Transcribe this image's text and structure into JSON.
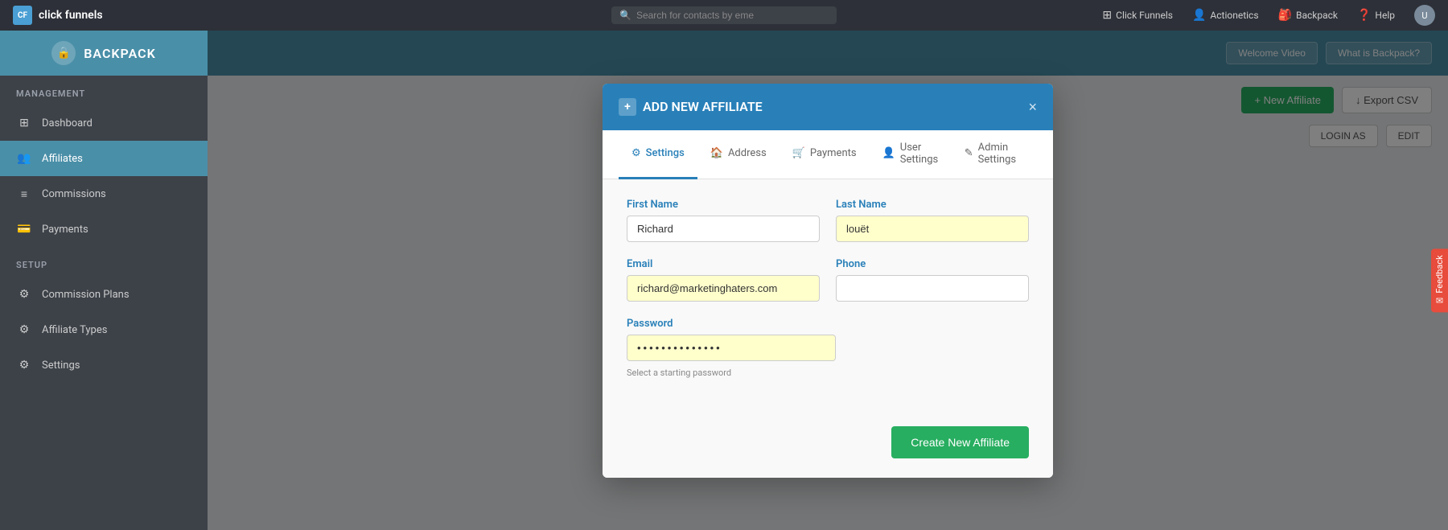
{
  "navbar": {
    "brand_icon": "CF",
    "brand_name": "click funnels",
    "search_placeholder": "Search for contacts by eme",
    "links": [
      {
        "id": "clickfunnels",
        "icon": "⊞",
        "label": "Click Funnels"
      },
      {
        "id": "actionetics",
        "icon": "👤",
        "label": "Actionetics"
      },
      {
        "id": "backpack",
        "icon": "🎒",
        "label": "Backpack"
      },
      {
        "id": "help",
        "icon": "?",
        "label": "Help"
      }
    ],
    "avatar_initials": "U"
  },
  "sidebar": {
    "title": "BACKPACK",
    "header_icon": "🔒",
    "section_management": "MANAGEMENT",
    "items_management": [
      {
        "id": "dashboard",
        "icon": "⊞",
        "label": "Dashboard",
        "active": false
      },
      {
        "id": "affiliates",
        "icon": "👤+",
        "label": "Affiliates",
        "active": true
      },
      {
        "id": "commissions",
        "icon": "≡",
        "label": "Commissions",
        "active": false
      },
      {
        "id": "payments",
        "icon": "💳",
        "label": "Payments",
        "active": false
      }
    ],
    "section_setup": "SETUP",
    "items_setup": [
      {
        "id": "commission-plans",
        "icon": "⚙",
        "label": "Commission Plans",
        "active": false
      },
      {
        "id": "affiliate-types",
        "icon": "⚙",
        "label": "Affiliate Types",
        "active": false
      },
      {
        "id": "settings",
        "icon": "⚙",
        "label": "Settings",
        "active": false
      }
    ]
  },
  "topbar": {
    "welcome_video_label": "Welcome Video",
    "what_is_backpack_label": "What is Backpack?"
  },
  "content_actions": {
    "new_affiliate_label": "+ New Affiliate",
    "export_csv_label": "↓ Export CSV",
    "login_as_label": "LOGIN AS",
    "edit_label": "EDIT"
  },
  "modal": {
    "title": "ADD NEW AFFILIATE",
    "title_icon": "+",
    "close_icon": "×",
    "tabs": [
      {
        "id": "settings",
        "icon": "⚙",
        "label": "Settings",
        "active": true
      },
      {
        "id": "address",
        "icon": "🏠",
        "label": "Address",
        "active": false
      },
      {
        "id": "payments",
        "icon": "🛒",
        "label": "Payments",
        "active": false
      },
      {
        "id": "user-settings",
        "icon": "👤",
        "label": "User Settings",
        "active": false
      },
      {
        "id": "admin-settings",
        "icon": "✎",
        "label": "Admin Settings",
        "active": false
      }
    ],
    "form": {
      "first_name_label": "First Name",
      "first_name_value": "Richard",
      "last_name_label": "Last Name",
      "last_name_value": "louët",
      "email_label": "Email",
      "email_value": "richard@marketinghaters.com",
      "phone_label": "Phone",
      "phone_value": "",
      "password_label": "Password",
      "password_value": "••••••••••••••",
      "password_hint": "Select a starting password"
    },
    "create_button_label": "Create New Affiliate"
  },
  "feedback": {
    "label": "Feedback"
  }
}
